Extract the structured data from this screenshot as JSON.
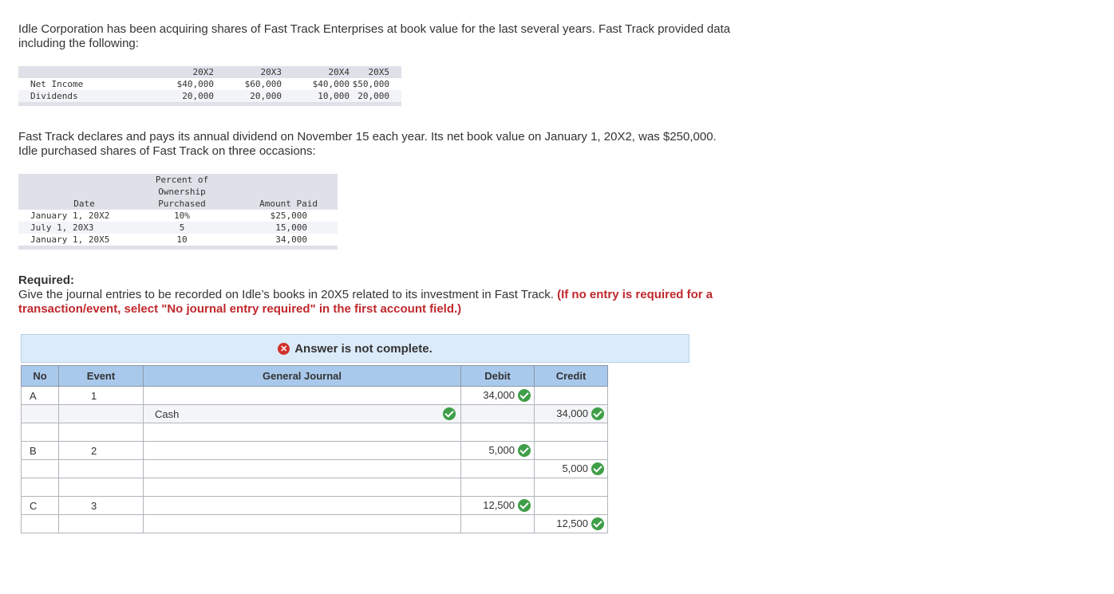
{
  "intro": {
    "line1": "Idle Corporation has been acquiring shares of Fast Track Enterprises at book value for the last several years. Fast Track provided data",
    "line2": "including the following:"
  },
  "income_table": {
    "years": [
      "20X2",
      "20X3",
      "20X4",
      "20X5"
    ],
    "rows": [
      {
        "label": "Net Income",
        "values": [
          "$40,000",
          "$60,000",
          "$40,000",
          "$50,000"
        ]
      },
      {
        "label": "Dividends",
        "values": [
          "20,000",
          "20,000",
          "10,000",
          "20,000"
        ]
      }
    ]
  },
  "middle": {
    "line1": "Fast Track declares and pays its annual dividend on November 15 each year. Its net book value on January 1, 20X2, was $250,000.",
    "line2": "Idle purchased shares of Fast Track on three occasions:"
  },
  "purchase_table": {
    "header_date": "Date",
    "header_pct_1": "Percent of",
    "header_pct_2": "Ownership",
    "header_pct_3": "Purchased",
    "header_amount": "Amount Paid",
    "rows": [
      {
        "date": "January 1, 20X2",
        "pct": "10%",
        "amount": "$25,000"
      },
      {
        "date": "July 1, 20X3",
        "pct": "5",
        "amount": "15,000"
      },
      {
        "date": "January 1, 20X5",
        "pct": "10",
        "amount": "34,000"
      }
    ]
  },
  "required": {
    "title": "Required:",
    "text": "Give the journal entries to be recorded on Idle’s books in 20X5 related to its investment in Fast Track.",
    "note": "(If no entry is required for a transaction/event, select \"No journal entry required\" in the first account field.)"
  },
  "banner": {
    "icon": "x-circle-icon",
    "text": "Answer is not complete."
  },
  "journal": {
    "headers": {
      "no": "No",
      "event": "Event",
      "journal": "General Journal",
      "debit": "Debit",
      "credit": "Credit"
    },
    "rows": [
      {
        "no": "A",
        "event": "1",
        "account": "",
        "debit": "34,000",
        "credit": "",
        "acct_check": false,
        "debit_check": true,
        "credit_check": false
      },
      {
        "no": "",
        "event": "",
        "account": "Cash",
        "debit": "",
        "credit": "34,000",
        "acct_check": true,
        "debit_check": false,
        "credit_check": true
      },
      {
        "no": "",
        "event": "",
        "account": "",
        "debit": "",
        "credit": "",
        "acct_check": false,
        "debit_check": false,
        "credit_check": false
      },
      {
        "no": "B",
        "event": "2",
        "account": "",
        "debit": "5,000",
        "credit": "",
        "acct_check": false,
        "debit_check": true,
        "credit_check": false
      },
      {
        "no": "",
        "event": "",
        "account": "",
        "debit": "",
        "credit": "5,000",
        "acct_check": false,
        "debit_check": false,
        "credit_check": true
      },
      {
        "no": "",
        "event": "",
        "account": "",
        "debit": "",
        "credit": "",
        "acct_check": false,
        "debit_check": false,
        "credit_check": false
      },
      {
        "no": "C",
        "event": "3",
        "account": "",
        "debit": "12,500",
        "credit": "",
        "acct_check": false,
        "debit_check": true,
        "credit_check": false
      },
      {
        "no": "",
        "event": "",
        "account": "",
        "debit": "",
        "credit": "12,500",
        "acct_check": false,
        "debit_check": false,
        "credit_check": true
      }
    ]
  },
  "colors": {
    "header_blue": "#a9c9ec",
    "banner_bg": "#dcebf9",
    "check_green": "#3f9e48",
    "error_red": "#d0312d",
    "note_red": "#c0282d"
  }
}
